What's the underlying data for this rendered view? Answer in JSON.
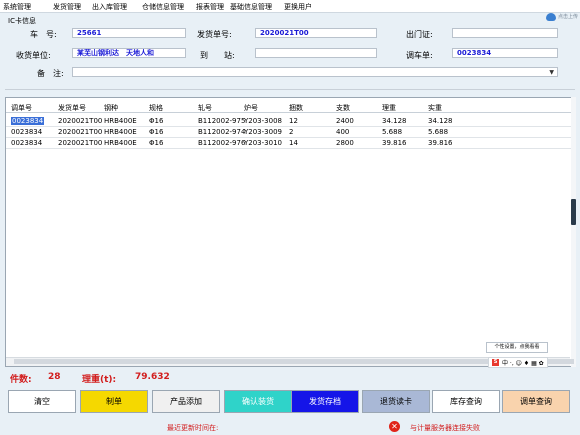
{
  "menu": [
    "系统管理",
    "发货管理",
    "出入库管理",
    "仓储信息管理",
    "报表管理",
    "基础信息管理",
    "更换用户"
  ],
  "cloud_label": "点击上传",
  "ic_info": {
    "title": "IC卡信息",
    "vehicle_label": "车　号:",
    "vehicle_value": "25661",
    "ship_no_label": "发货单号:",
    "ship_no_value": "2020021T00",
    "exit_pass_label": "出门证:",
    "exit_pass_value": "",
    "receiver_label": "收货单位:",
    "receiver_value": "某芜山钢利达　天地人和",
    "station_label": "到　　站:",
    "station_value": "",
    "dispatch_label": "调车单:",
    "dispatch_value": "0023834",
    "remark_label": "备　注:",
    "remark_value": ""
  },
  "table": {
    "columns": [
      "调单号",
      "发货单号",
      "钢种",
      "规格",
      "轧号",
      "炉号",
      "捆数",
      "支数",
      "理重",
      "实重"
    ],
    "rows": [
      [
        "0023834",
        "2020021T00",
        "HRB400E",
        "Φ16",
        "B112002-975",
        "Y203-3008",
        "12",
        "2400",
        "34.128",
        "34.128"
      ],
      [
        "0023834",
        "2020021T00",
        "HRB400E",
        "Φ16",
        "B112002-974",
        "Y203-3009",
        "2",
        "400",
        "5.688",
        "5.688"
      ],
      [
        "0023834",
        "2020021T00",
        "HRB400E",
        "Φ16",
        "B112002-976",
        "Y203-3010",
        "14",
        "2800",
        "39.816",
        "39.816"
      ]
    ]
  },
  "tooltip": "个性设置，点我看看",
  "ime": "中 ·, ☺ ♦ ▦ ✿",
  "summary": {
    "count_label": "件数:",
    "count_value": "28",
    "weight_label": "理重(t):",
    "weight_value": "79.632"
  },
  "buttons": [
    {
      "label": "清空",
      "bg": "#ffffff",
      "fg": "#000000"
    },
    {
      "label": "制单",
      "bg": "#f5d800",
      "fg": "#000000"
    },
    {
      "label": "产品添加",
      "bg": "#f0f0f0",
      "fg": "#000000"
    },
    {
      "label": "确认装货",
      "bg": "#2fd3c9",
      "fg": "#ffffff"
    },
    {
      "label": "发货存档",
      "bg": "#1515e8",
      "fg": "#ffffff"
    },
    {
      "label": "退货读卡",
      "bg": "#a9b8d6",
      "fg": "#000000"
    },
    {
      "label": "库存查询",
      "bg": "#ffffff",
      "fg": "#000000"
    },
    {
      "label": "调单查询",
      "bg": "#f9d3ad",
      "fg": "#000000"
    }
  ],
  "status": {
    "last_update": "最近更新时间在:",
    "server_error": "与计量服务器连接失败",
    "error_color": "#d21d1d"
  }
}
